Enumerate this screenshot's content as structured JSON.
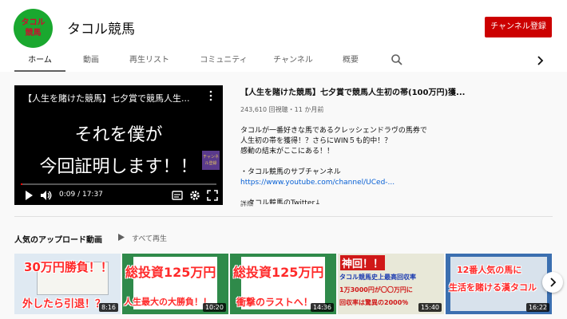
{
  "channel": {
    "logo_text_1": "タコル",
    "logo_text_2": "競馬",
    "name": "タコル競馬",
    "subscribe_label": "チャンネル登録"
  },
  "tabs": [
    {
      "label": "ホーム",
      "active": true
    },
    {
      "label": "動画"
    },
    {
      "label": "再生リスト"
    },
    {
      "label": "コミュニティ"
    },
    {
      "label": "チャンネル"
    },
    {
      "label": "概要"
    }
  ],
  "icons": [
    "search-icon",
    "chevron-right-icon",
    "more-vert-icon",
    "play-icon",
    "volume-icon",
    "subtitles-icon",
    "settings-icon",
    "fullscreen-icon"
  ],
  "colors": {
    "subscribe": "#cc0000",
    "link": "#065fd4",
    "progress": "#ff0000",
    "avatar_bg": "#1aa82f"
  },
  "featured": {
    "player": {
      "title": "【人生を賭けた競馬】七夕賞で競馬人生...",
      "caption_1": "それを僕が",
      "caption_2": "今回証明します！！",
      "badge": "チャンネル登録",
      "time": "0:09 / 17:37",
      "progress": 0.0085
    },
    "title": "【人生を賭けた競馬】七夕賞で競馬人生初の帯(100万円)獲...",
    "meta": "243,610 回視聴・11 か月前",
    "description_lines": [
      "タコルが一番好きな馬であるクレッシェンドラヴの馬券で",
      "人生初の帯を獲得！？さらにWIN５も的中！？",
      "感動の結末がここにある！！"
    ],
    "sub_channel_label": "・タコル競馬のサブチャンネル",
    "sub_channel_url": "https://www.youtube.com/channel/UCed-...",
    "twitter_label": "・タコル競馬のTwitter↓",
    "more_label": "詳細"
  },
  "popular": {
    "title": "人気のアップロード動画",
    "play_all_label": "すべて再生",
    "videos": [
      {
        "caption_top": "30万円勝負！！",
        "caption_bottom": "外したら引退！？",
        "duration": "8:16",
        "bg": "#dfe9f2"
      },
      {
        "caption_top": "総投資125万円",
        "caption_bottom": "人生最大の大勝負！！",
        "duration": "10:20",
        "bg": "#2f8a4a"
      },
      {
        "caption_top": "総投資125万円",
        "caption_bottom": "衝撃のラストへ！",
        "duration": "14:36",
        "bg": "#2f8a4a"
      },
      {
        "caption_top": "神回！！",
        "caption_mid": "タコル競馬史上最高回収率",
        "caption_line3": "1万3000円が〇〇万円に",
        "caption_bottom": "回収率は驚異の2000％",
        "duration": "15:40",
        "bg": "#e8e8d8"
      },
      {
        "caption_top": "12番人気の馬に",
        "caption_bottom": "生活を賭ける漢タコル",
        "duration": "16:22",
        "bg": "#3b6fb0"
      }
    ]
  }
}
